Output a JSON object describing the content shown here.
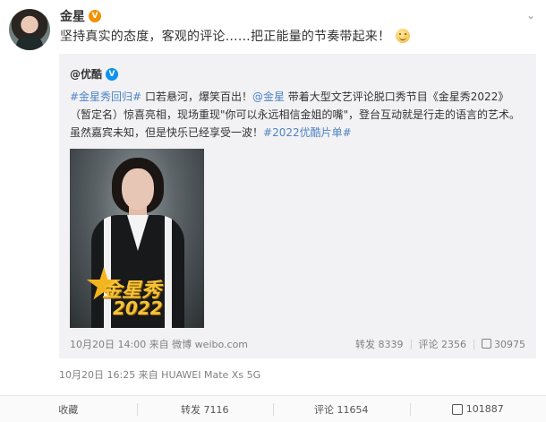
{
  "post": {
    "author": "金星",
    "text": "坚持真实的态度，客观的评论……把正能量的节奏带起来！",
    "meta": "10月20日 16:25  来自 HUAWEI Mate Xs 5G"
  },
  "repost": {
    "author": "@优酷",
    "hashtag_1": "#金星秀回归#",
    "text_1": " 口若悬河，爆笑百出！",
    "mention": "@金星",
    "text_2": " 带着大型文艺评论脱口秀节目《金星秀2022》（暂定名）惊喜亮相，现场重现\"你可以永远相信金姐的嘴\"，登台互动就是行走的语言的艺术。虽然嘉宾未知，但是快乐已经享受一波！",
    "hashtag_2": "#2022优酷片单#",
    "poster_logo": "金星秀",
    "poster_year": "2022",
    "meta": "10月20日 14:00  来自 微博 weibo.com",
    "repost_label": "转发 8339",
    "comment_label": "评论 2356",
    "like_count": "30975"
  },
  "actions": {
    "favorite": "收藏",
    "repost": "转发 7116",
    "comment": "评论 11654",
    "like": "101887"
  },
  "colors": {
    "link": "#4e83c5",
    "verified_orange": "#f29100",
    "verified_blue": "#0c93ef"
  }
}
